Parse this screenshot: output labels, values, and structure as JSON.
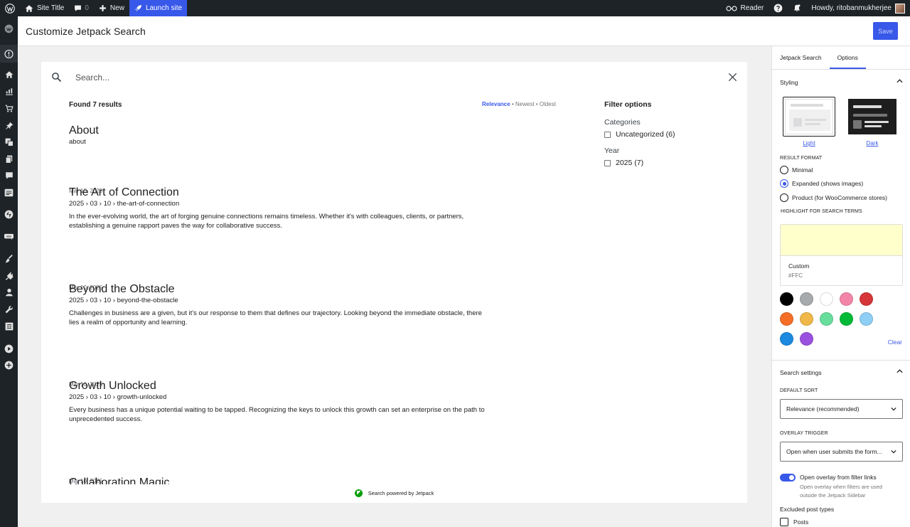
{
  "adminbar": {
    "site_title": "Site Title",
    "comments_count": "0",
    "new_label": "New",
    "launch_label": "Launch site",
    "reader_label": "Reader",
    "howdy": "Howdy, ritobanmukherjee"
  },
  "header": {
    "title": "Customize Jetpack Search",
    "save_label": "Save"
  },
  "search": {
    "placeholder": "Search..."
  },
  "results": {
    "found": "Found 7 results",
    "sort": {
      "relevance": "Relevance",
      "newest": "Newest",
      "oldest": "Oldest",
      "sep": "•"
    },
    "items": [
      {
        "title": "About",
        "path": "about",
        "excerpt": "",
        "date": "Mar 10, 2025"
      },
      {
        "title": "The Art of Connection",
        "path": "2025 › 03 › 10 › the-art-of-connection",
        "excerpt": "In the ever-evolving world, the art of forging genuine connections remains timeless. Whether it's with colleagues, clients, or partners, establishing a genuine rapport paves the way for collaborative success.",
        "date": "Mar 10, 2025"
      },
      {
        "title": "Beyond the Obstacle",
        "path": "2025 › 03 › 10 › beyond-the-obstacle",
        "excerpt": "Challenges in business are a given, but it's our response to them that defines our trajectory. Looking beyond the immediate obstacle, there lies a realm of opportunity and learning.",
        "date": "Mar 10, 2025"
      },
      {
        "title": "Growth Unlocked",
        "path": "2025 › 03 › 10 › growth-unlocked",
        "excerpt": "Every business has a unique potential waiting to be tapped. Recognizing the keys to unlock this growth can set an enterprise on the path to unprecedented success.",
        "date": "Mar 10, 2025"
      },
      {
        "title": "Collaboration Magic",
        "path": "",
        "excerpt": "",
        "date": ""
      }
    ],
    "powered_by": "Search powered by Jetpack"
  },
  "filters": {
    "title": "Filter options",
    "groups": [
      {
        "name": "Categories",
        "options": [
          "Uncategorized (6)"
        ]
      },
      {
        "name": "Year",
        "options": [
          "2025 (7)"
        ]
      }
    ]
  },
  "sidebar": {
    "tabs": [
      "Jetpack Search",
      "Options"
    ],
    "active_tab": "Options",
    "styling": {
      "heading": "Styling",
      "themes": [
        "Light",
        "Dark"
      ],
      "selected_theme": "Light",
      "result_format_label": "RESULT FORMAT",
      "formats": [
        "Minimal",
        "Expanded (shows images)",
        "Product (for WooCommerce stores)"
      ],
      "selected_format": "Expanded (shows images)",
      "highlight_label": "HIGHLIGHT FOR SEARCH TERMS",
      "highlight_name": "Custom",
      "highlight_hex": "#FFC",
      "highlight_color": "#ffffcc",
      "palette": [
        "#000000",
        "#a7aaad",
        "#ffffff",
        "#f386a8",
        "#d63638",
        "#f56e28",
        "#f0b849",
        "#68de9c",
        "#00ba37",
        "#8fcff5",
        "#1b8ae0",
        "#9b51e0"
      ],
      "clear_label": "Clear"
    },
    "search_settings": {
      "heading": "Search settings",
      "default_sort_label": "DEFAULT SORT",
      "default_sort_value": "Relevance (recommended)",
      "overlay_trigger_label": "OVERLAY TRIGGER",
      "overlay_trigger_value": "Open when user submits the form...",
      "toggle_label": "Open overlay from filter links",
      "toggle_help": "Open overlay when filters are used outside the Jetpack Sidebar",
      "excluded_label": "Excluded post types",
      "excluded_options": [
        "Posts"
      ]
    }
  },
  "colors": {
    "accent": "#3858e9",
    "adminbar": "#1d2327",
    "jetpack_green": "#069e08"
  }
}
